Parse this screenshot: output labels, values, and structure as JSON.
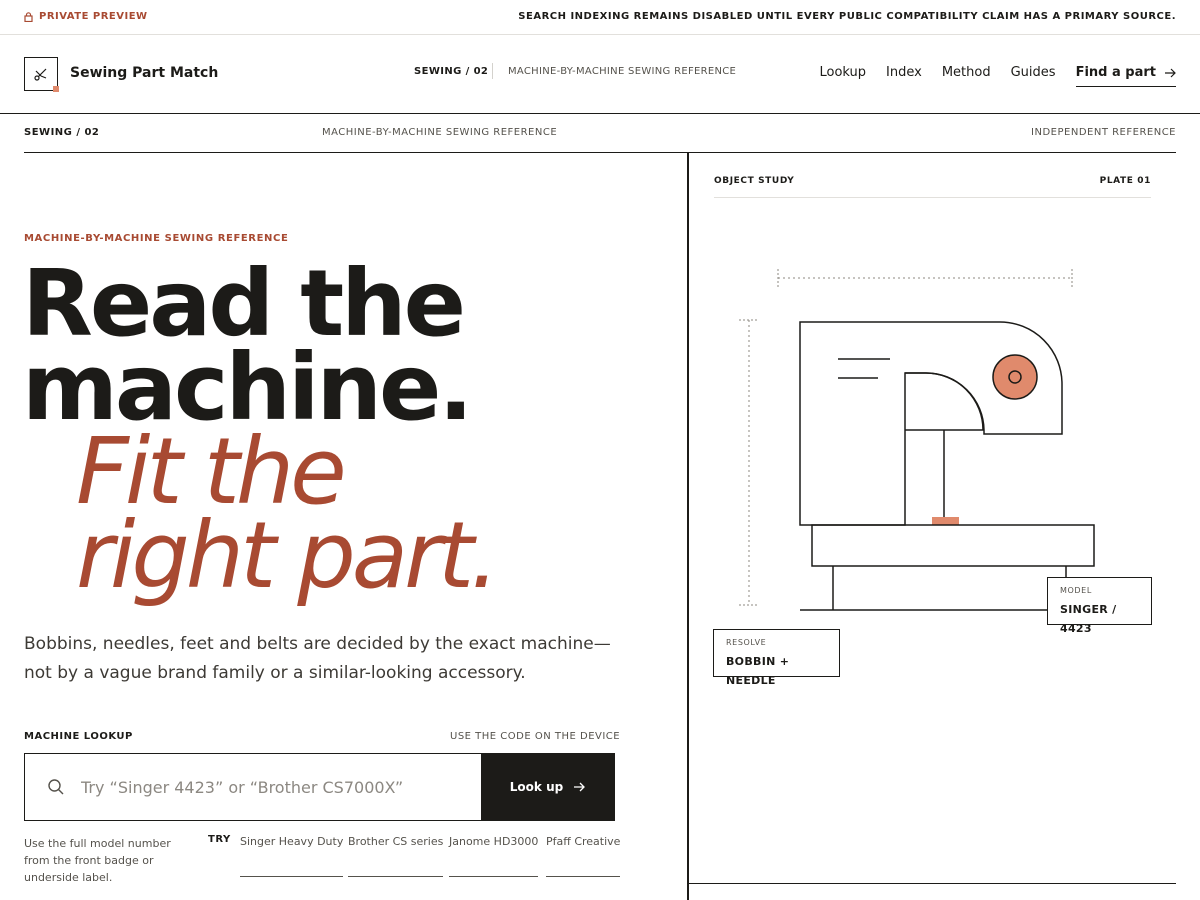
{
  "topbar": {
    "preview_label": "PRIVATE PREVIEW",
    "notice": "SEARCH INDEXING REMAINS DISABLED UNTIL EVERY PUBLIC COMPATIBILITY CLAIM HAS A PRIMARY SOURCE."
  },
  "header": {
    "brand": "Sewing Part Match",
    "crumb": "SEWING / 02",
    "crumb_sub": "MACHINE-BY-MACHINE SEWING REFERENCE",
    "nav": [
      "Lookup",
      "Index",
      "Method",
      "Guides"
    ],
    "find_label": "Find a part"
  },
  "subbar": {
    "left": "SEWING / 02",
    "middle": "MACHINE-BY-MACHINE SEWING REFERENCE",
    "right": "INDEPENDENT REFERENCE"
  },
  "hero": {
    "eyebrow": "MACHINE-BY-MACHINE SEWING REFERENCE",
    "line1": "Read the",
    "line2": "machine.",
    "line3": "Fit the",
    "line4": "right part.",
    "lede": "Bobbins, needles, feet and belts are decided by the exact machine—not by a vague brand family or a similar-looking accessory."
  },
  "lookup": {
    "label": "MACHINE LOOKUP",
    "hint": "USE THE CODE ON THE DEVICE",
    "placeholder": "Try “Singer 4423” or “Brother CS7000X”",
    "value": "",
    "button": "Look up",
    "help": "Use the full model number from the front badge or underside label.",
    "try_label": "TRY",
    "suggestions": [
      "Singer Heavy Duty",
      "Brother CS series",
      "Janome HD3000",
      "Pfaff Creative"
    ]
  },
  "study": {
    "label": "OBJECT STUDY",
    "plate": "PLATE 01",
    "model_key": "MODEL",
    "model_value": "SINGER / 4423",
    "resolve_key": "RESOLVE",
    "resolve_value": "BOBBIN + NEEDLE"
  },
  "colors": {
    "accent": "#a84a32",
    "accent_light": "#e08a6c",
    "ink": "#1c1b18"
  }
}
